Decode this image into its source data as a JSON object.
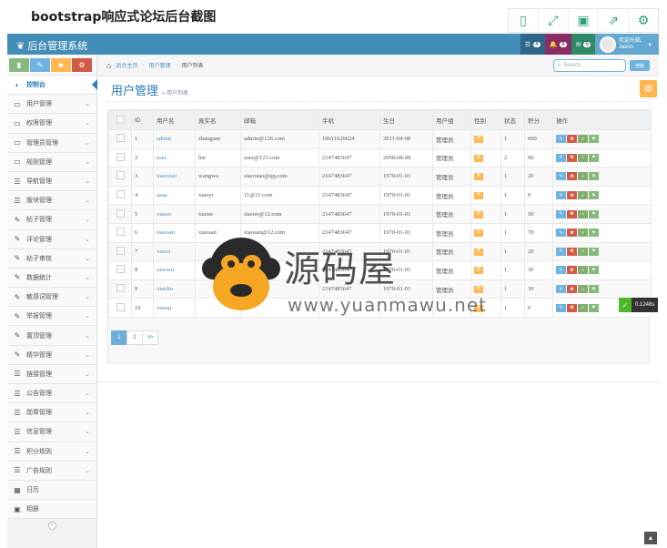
{
  "page_title": "bootstrap响应式论坛后台截图",
  "toolbar": [
    "qr-code-icon",
    "fullscreen-icon",
    "save-icon",
    "share-icon",
    "gear-icon"
  ],
  "navbar": {
    "brand": "后台管理系统",
    "tasks_badge": "4",
    "notifications_badge": "8",
    "messages_badge": "5",
    "welcome": "欢迎光临,",
    "username": "Jason"
  },
  "sidebar": {
    "items": [
      {
        "label": "控制台",
        "icon": "dashboard-icon",
        "active": true
      },
      {
        "label": "用户管理",
        "icon": "desktop-icon"
      },
      {
        "label": "权限管理",
        "icon": "desktop-icon"
      },
      {
        "label": "管理员管理",
        "icon": "desktop-icon"
      },
      {
        "label": "规则管理",
        "icon": "desktop-icon"
      },
      {
        "label": "导航管理",
        "icon": "list-icon"
      },
      {
        "label": "版块管理",
        "icon": "list-icon"
      },
      {
        "label": "帖子管理",
        "icon": "edit-icon"
      },
      {
        "label": "评论管理",
        "icon": "edit-icon"
      },
      {
        "label": "帖子审核",
        "icon": "edit-icon"
      },
      {
        "label": "数据统计",
        "icon": "edit-icon"
      },
      {
        "label": "敏感词管理",
        "icon": "edit-icon"
      },
      {
        "label": "举报管理",
        "icon": "edit-icon"
      },
      {
        "label": "置顶管理",
        "icon": "edit-icon"
      },
      {
        "label": "精华管理",
        "icon": "edit-icon"
      },
      {
        "label": "链接管理",
        "icon": "list-icon"
      },
      {
        "label": "公告管理",
        "icon": "list-icon"
      },
      {
        "label": "勋章管理",
        "icon": "list-icon"
      },
      {
        "label": "信息管理",
        "icon": "list-icon"
      },
      {
        "label": "积分规则",
        "icon": "list-icon"
      },
      {
        "label": "广告规则",
        "icon": "list-icon"
      },
      {
        "label": "日历",
        "icon": "calendar-icon",
        "nochev": true
      },
      {
        "label": "相册",
        "icon": "picture-icon",
        "nochev": true
      }
    ]
  },
  "breadcrumb": {
    "home": "后台主页",
    "section": "用户管理",
    "current": "用户列表"
  },
  "search": {
    "placeholder": "Search ...",
    "button": "搜索"
  },
  "header": {
    "title": "用户管理",
    "subtitle": "» 用户列表"
  },
  "table": {
    "columns": [
      "",
      "ID",
      "用户名",
      "真实名",
      "邮箱",
      "手机",
      "生日",
      "用户组",
      "性别",
      "状态",
      "积分",
      "操作"
    ],
    "rows": [
      {
        "id": "1",
        "username": "admin",
        "realname": "zhangsan",
        "email": "admin@126.com",
        "phone": "18611626624",
        "birthday": "2011-04-08",
        "group": "管理员",
        "sex": "男",
        "status": "1",
        "points": "660"
      },
      {
        "id": "2",
        "username": "user",
        "realname": "lisi",
        "email": "user@123.com",
        "phone": "2147483647",
        "birthday": "2008-08-08",
        "group": "管理员",
        "sex": "女",
        "status": "2",
        "points": "90"
      },
      {
        "id": "3",
        "username": "xiaoxiao",
        "realname": "wangwu",
        "email": "xiaoxiao@qq.com",
        "phone": "2147483647",
        "birthday": "1970-01-01",
        "group": "管理员",
        "sex": "男",
        "status": "1",
        "points": "20"
      },
      {
        "id": "4",
        "username": "aaaa",
        "realname": "xiaoyi",
        "email": "11@11.com",
        "phone": "2147483647",
        "birthday": "1970-01-01",
        "group": "管理员",
        "sex": "男",
        "status": "1",
        "points": "0"
      },
      {
        "id": "5",
        "username": "xiaoer",
        "realname": "xiaoer",
        "email": "xiaoer@12.com",
        "phone": "2147483647",
        "birthday": "1970-01-01",
        "group": "管理员",
        "sex": "女",
        "status": "1",
        "points": "50"
      },
      {
        "id": "6",
        "username": "xiaosan",
        "realname": "xiaosan",
        "email": "xiaosan@12.com",
        "phone": "2147483647",
        "birthday": "1970-01-01",
        "group": "管理员",
        "sex": "女",
        "status": "1",
        "points": "70"
      },
      {
        "id": "7",
        "username": "xiaosi",
        "realname": "",
        "email": "",
        "phone": "2147483647",
        "birthday": "1970-01-01",
        "group": "管理员",
        "sex": "男",
        "status": "1",
        "points": "20"
      },
      {
        "id": "8",
        "username": "xiaowu",
        "realname": "",
        "email": "",
        "phone": "2147483647",
        "birthday": "1970-01-01",
        "group": "管理员",
        "sex": "男",
        "status": "1",
        "points": "30"
      },
      {
        "id": "9",
        "username": "xiaoliu",
        "realname": "",
        "email": "",
        "phone": "2147483647",
        "birthday": "1970-01-01",
        "group": "管理员",
        "sex": "男",
        "status": "1",
        "points": "30"
      },
      {
        "id": "10",
        "username": "xiaoqi",
        "realname": "",
        "email": "",
        "phone": "",
        "birthday": "",
        "group": "",
        "sex": "女",
        "status": "1",
        "points": "0"
      }
    ]
  },
  "pagination": [
    "1",
    "2",
    ">>"
  ],
  "perf_readout": "0.1248s",
  "watermark": {
    "title": "源码屋",
    "url": "www.yuanmawu.net"
  },
  "colors": {
    "navbar": "#438eb9",
    "accent": "#2679b5",
    "orange": "#ffb752",
    "red": "#d15b47",
    "green": "#87b87f"
  }
}
